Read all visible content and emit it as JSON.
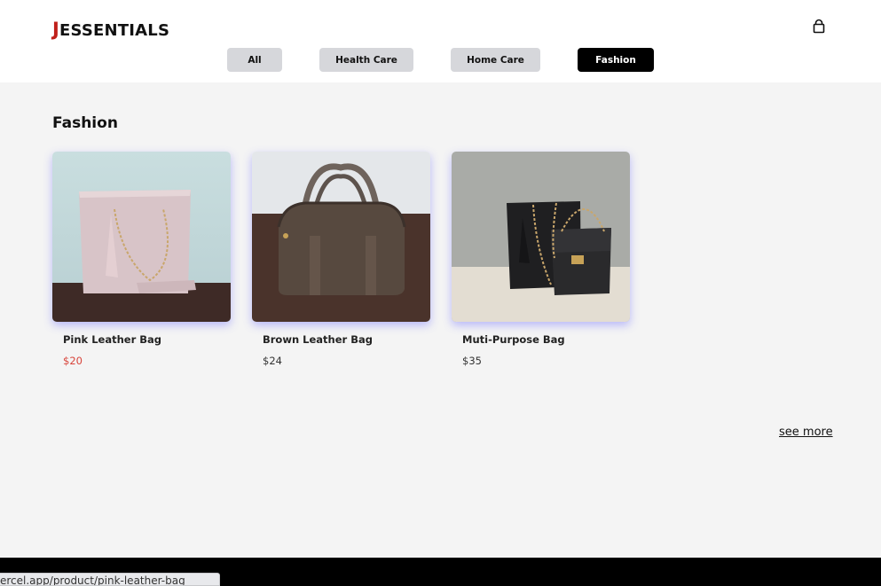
{
  "header": {
    "logo_accent": "J",
    "logo_rest": "ESSENTIALS",
    "cart_icon": "shopping-bag-icon"
  },
  "filters": [
    {
      "label": "All",
      "active": false
    },
    {
      "label": "Health Care",
      "active": false
    },
    {
      "label": "Home Care",
      "active": false
    },
    {
      "label": "Fashion",
      "active": true
    }
  ],
  "section": {
    "title": "Fashion"
  },
  "products": [
    {
      "name": "Pink Leather Bag",
      "price": "$20",
      "price_color": "#d8443b"
    },
    {
      "name": "Brown Leather Bag",
      "price": "$24",
      "price_color": "#333333"
    },
    {
      "name": "Muti-Purpose Bag",
      "price": "$35",
      "price_color": "#333333"
    }
  ],
  "see_more": "see more",
  "status_bar": {
    "url": "ercel.app/product/pink-leather-bag"
  },
  "colors": {
    "accent": "#c0201a",
    "active_filter_bg": "#000000",
    "inactive_filter_bg": "#d6d7db",
    "page_bg": "#f4f4f4"
  }
}
